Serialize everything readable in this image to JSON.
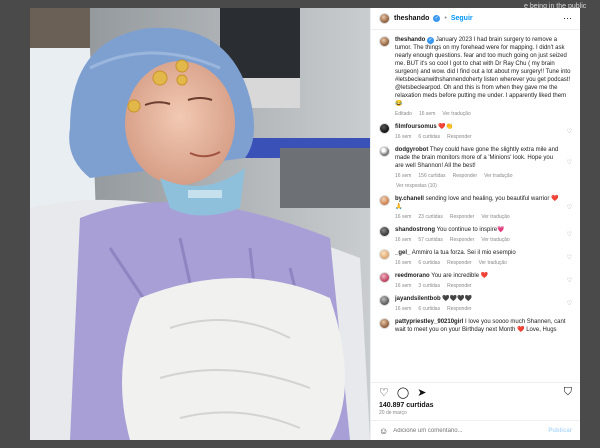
{
  "background_text": "e being in the public eye. And to",
  "post": {
    "username": "theshando",
    "follow_label": "Seguir",
    "caption_user": "theshando",
    "caption": "January 2023 I had brain surgery to remove a tumor. The things on my forehead were for mapping. I didn't ask nearly enough questions. fear and too much going on just seized me. BUT it's so cool I got to chat with Dr Ray Chu ( my brain surgeon) and wow. did I find out a lot about my surgery!! Tune into #letsbecleanwithshannendoherty listen wherever you get podcast! @letsbeclearpod. Oh and this is from when they gave me the relaxation meds before putting me under. I apparently liked them 😂",
    "caption_edited": "Editado",
    "caption_time": "16 sem",
    "caption_translate": "Ver tradução",
    "likes": "140.897 curtidas",
    "date": "20 de março",
    "comment_placeholder": "Adicione um comentário...",
    "publish_label": "Publicar"
  },
  "comments": [
    {
      "user": "filmfoursomus",
      "text": "❤️👏",
      "time": "16 sem",
      "likes": "6 curtidas",
      "reply": "Responder",
      "translate": ""
    },
    {
      "user": "dodgyrobot",
      "text": "They could have gone the slightly extra mile and made the brain monitors more of a 'Minions' look. Hope you are well Shannon! All the best!",
      "time": "16 sem",
      "likes": "156 curtidas",
      "reply": "Responder",
      "translate": "Ver tradução",
      "replies": "Ver respostas (10)"
    },
    {
      "user": "by.chanell",
      "text": "sending love and healing, you beautiful warrior ❤️🙏",
      "time": "16 sem",
      "likes": "23 curtidas",
      "reply": "Responder",
      "translate": "Ver tradução"
    },
    {
      "user": "shandostrong",
      "text": "You continue to inspire💗",
      "time": "16 sem",
      "likes": "57 curtidas",
      "reply": "Responder",
      "translate": "Ver tradução"
    },
    {
      "user": "_gel_",
      "text": "Ammiro la tua forza. Sei il mio esempio",
      "time": "16 sem",
      "likes": "6 curtidas",
      "reply": "Responder",
      "translate": "Ver tradução"
    },
    {
      "user": "reedmorano",
      "text": "You are incredible ❤️",
      "time": "16 sem",
      "likes": "3 curtidas",
      "reply": "Responder",
      "translate": ""
    },
    {
      "user": "jayandsilentbob",
      "text": "🖤🖤🖤🖤",
      "time": "16 sem",
      "likes": "6 curtidas",
      "reply": "Responder",
      "translate": ""
    },
    {
      "user": "pattypriestley_90210girl",
      "text": "I love you soooo much Shannen, cant wait to meet you on your Birthday next Month ❤️ Love, Hugs",
      "time": "",
      "likes": "",
      "reply": "",
      "translate": ""
    }
  ],
  "icons": {
    "more": "more-horizontal-icon",
    "like": "heart-icon",
    "comment": "comment-bubble-icon",
    "share": "send-icon",
    "save": "bookmark-icon",
    "emoji": "smiley-icon"
  },
  "colors": {
    "accent": "#0095f6",
    "verified": "#3897f0",
    "text": "#262626",
    "muted": "#8e8e8e"
  }
}
